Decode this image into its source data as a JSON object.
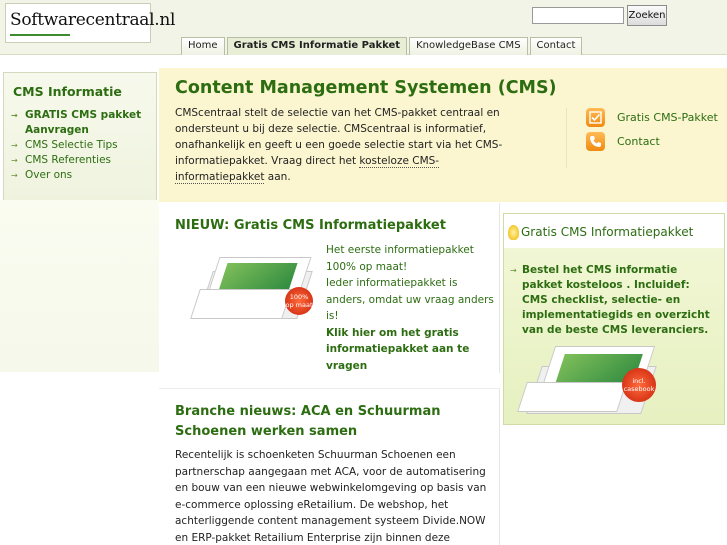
{
  "header": {
    "logo_text": "Softwarecentraal.nl",
    "search": {
      "placeholder": "",
      "button_label": "Zoeken"
    },
    "tabs": [
      {
        "label": "Home"
      },
      {
        "label": "Gratis CMS Informatie Pakket"
      },
      {
        "label": "KnowledgeBase CMS"
      },
      {
        "label": "Contact"
      }
    ]
  },
  "sidebar": {
    "title": "CMS Informatie",
    "items": [
      {
        "label": "GRATIS CMS pakket Aanvragen"
      },
      {
        "label": "CMS Selectie Tips"
      },
      {
        "label": "CMS Referenties"
      },
      {
        "label": "Over ons"
      }
    ]
  },
  "intro": {
    "title": "Content Management Systemen (CMS)",
    "text_before_link": "CMScentraal stelt de selectie van het CMS-pakket centraal en ondersteunt u bij deze selectie. CMScentraal is informatief, onafhankelijk en geeft u een goede selectie start via het CMS-informatiepakket. Vraag direct het ",
    "link": "kosteloze CMS-informatiepakket",
    "text_after_link": " aan.",
    "quick_links": [
      {
        "label": "Gratis CMS-Pakket",
        "icon": "checkbox-icon"
      },
      {
        "label": "Contact",
        "icon": "phone-icon"
      }
    ]
  },
  "news_card": {
    "title": "NIEUW: Gratis CMS Informatiepakket",
    "lines": [
      "Het eerste informatiepakket",
      "100% op maat!",
      "Ieder informatiepakket is anders, omdat uw vraag anders is!"
    ],
    "cta": "Klik hier om het gratis informatiepakket aan te vragen",
    "badge": "100% op maat"
  },
  "branch_card": {
    "title": "Branche nieuws: ACA en Schuurman Schoenen werken samen",
    "text": "Recentelijk is schoenketen Schuurman Schoenen een partnerschap aangegaan met ACA, voor de automatisering en bouw van een nieuwe webwinkelomgeving op basis van e-commerce oplossing eRetailium. De webshop, het achterliggende content management systeem Divide.NOW en ERP-pakket Retailium Enterprise zijn binnen deze oplossing volledig met"
  },
  "promo": {
    "title": "Gratis CMS Informatiepakket",
    "text": "Bestel het CMS informatie pakket kosteloos . Incluidef: CMS checklist, selectie- en implementatiegids en overzicht van de beste CMS leveranciers.",
    "badge": "incl. casebook"
  }
}
